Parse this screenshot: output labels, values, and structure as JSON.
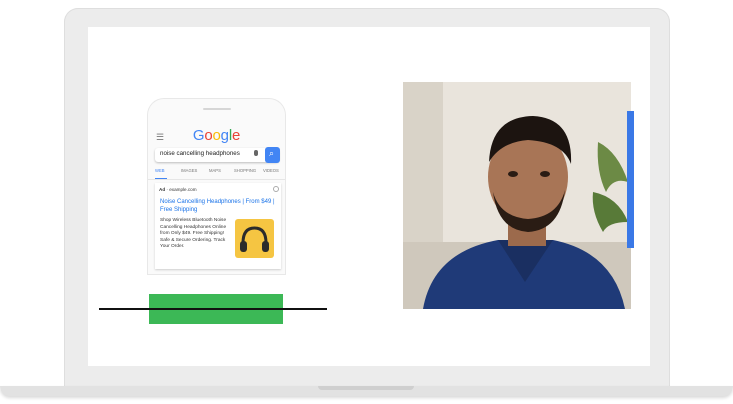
{
  "phone": {
    "logo": "Google",
    "search_query": "noise cancelling headphones",
    "tabs": [
      "WEB",
      "IMAGES",
      "MAPS",
      "SHOPPING",
      "VIDEOS"
    ],
    "ad": {
      "badge": "Ad",
      "url": "example.com",
      "title": "Noise Cancelling Headphones | From $49 | Free Shipping",
      "description": "Shop Wireless Bluetooth Noise Cancelling Headphones Online from Only $49. Free Shipping! Safe & Secure Ordering. Track Your Order."
    }
  },
  "colors": {
    "google_blue": "#4285f4",
    "google_red": "#ea4335",
    "google_yellow": "#fbbc05",
    "google_green": "#34a853",
    "green_bar": "#3cb856",
    "video_strip": "#3a78e6"
  },
  "icons": {
    "menu": "hamburger-icon",
    "mic": "mic-icon",
    "search": "search-icon",
    "info": "info-icon"
  }
}
